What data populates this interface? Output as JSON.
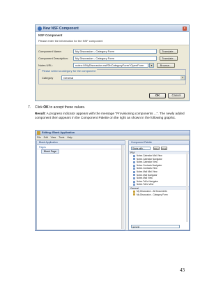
{
  "dialog": {
    "title": "New NSF Component",
    "header_title": "NSF Component",
    "header_message": "Please enter the information for the NSF component",
    "name_label": "Component Name:",
    "name_value": "My Discussion - Category Form",
    "description_label": "Component Description:",
    "description_value": "My Discussion - Category Form",
    "url_label": "Notes URL:",
    "url_value": "notes:///MyDiscussion.nsf/DbCategoryForm?OpenForm",
    "translate_label": "Translate...",
    "translate2_label": "Translate...",
    "browse_label": "Browse...",
    "category_prompt": "Please select a category for the component",
    "category_label": "Category",
    "category_value": "General",
    "ok_label": "OK",
    "cancel_label": "Cancel"
  },
  "instructions": {
    "step_number": "7.",
    "step_prefix": "Click ",
    "step_bold": "OK",
    "step_suffix": " to accept these values.",
    "result_bold": "Result",
    "result_text": ": A progress indicator appears with the message \"Provisioning components ...\". The newly added component then appears in the Component Palette on the right as shown in the following graphic."
  },
  "designer": {
    "title": "Editing: Blank Application",
    "menu": [
      "File",
      "Edit",
      "View",
      "Tools",
      "Help"
    ],
    "left_pane_title": "Blank Application",
    "left_pane_subtitle": "Pages",
    "form_tab": "Blank Page",
    "right_pane_title": "Component Palette",
    "palette_filter": "Starts with...",
    "palette_btn_a": "Filter",
    "palette_btn_b": "Clear",
    "section_a": "PIM",
    "pim_items": [
      "Notes Calendar Mini View",
      "Notes Calendar Navigator",
      "Notes Calendar View",
      "Notes Contacts Navigator",
      "Notes Contacts View",
      "Notes Mail Mini View",
      "Notes Mail Navigator",
      "Notes Mail View",
      "Notes ToDo Navigator",
      "Notes ToDo View"
    ],
    "section_b": "General",
    "general_items": [
      "My Discussion - All Documents",
      "My Discussion - Category Form"
    ],
    "search_value": "general"
  },
  "page_number": "43"
}
